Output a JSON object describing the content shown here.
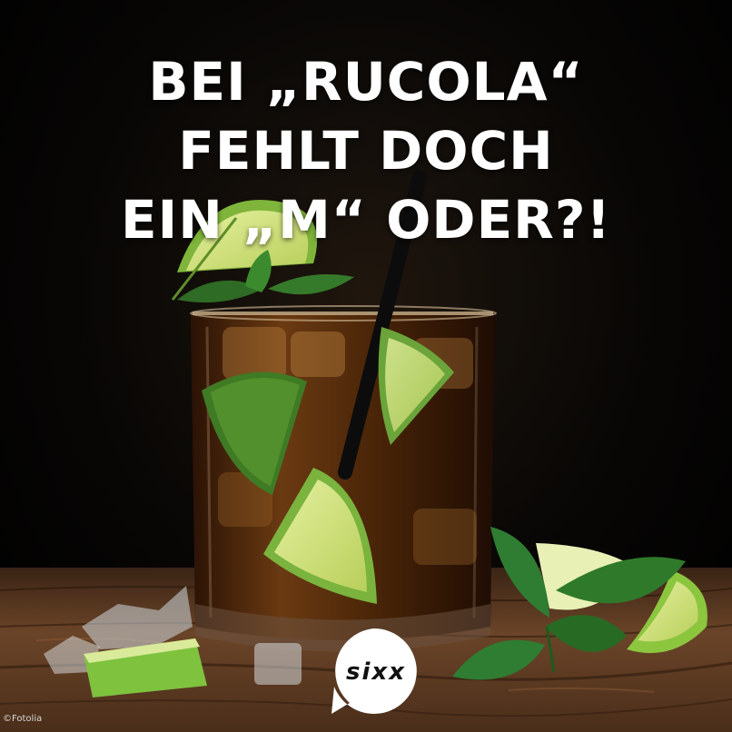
{
  "headline": {
    "line1": "BEI „RUCOLA“",
    "line2": "FEHLT DOCH",
    "line3": "EIN „M“ ODER?!"
  },
  "logo": {
    "name": "sixx-logo",
    "text": "sixx",
    "bg_color": "#ffffff",
    "text_color": "#111111"
  },
  "credit": "©Fotolia",
  "colors": {
    "background": "#000000",
    "wood": "#5a3a22",
    "drink": "#4a250c",
    "lime": "#8cc63f",
    "mint": "#2e7d32",
    "headline": "#ffffff"
  }
}
